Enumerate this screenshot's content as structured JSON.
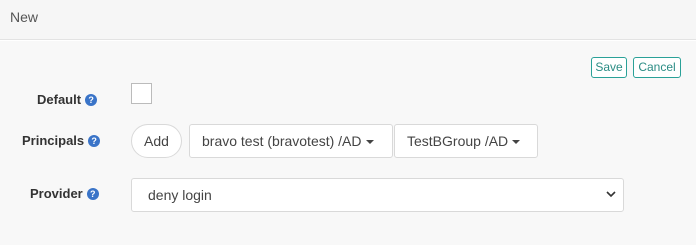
{
  "header": {
    "title": "New"
  },
  "actions": {
    "save_label": "Save",
    "cancel_label": "Cancel"
  },
  "form": {
    "default": {
      "label": "Default",
      "help_icon": "question-circle-icon",
      "checked": false
    },
    "principals": {
      "label": "Principals",
      "help_icon": "question-circle-icon",
      "add_label": "Add",
      "items": [
        {
          "label": "bravo test (bravotest) /AD"
        },
        {
          "label": "TestBGroup /AD"
        }
      ]
    },
    "provider": {
      "label": "Provider",
      "help_icon": "question-circle-icon",
      "selected": "deny login"
    }
  },
  "colors": {
    "accent": "#2aa198",
    "help_icon": "#3a74c8",
    "background": "#f8f8f8"
  }
}
